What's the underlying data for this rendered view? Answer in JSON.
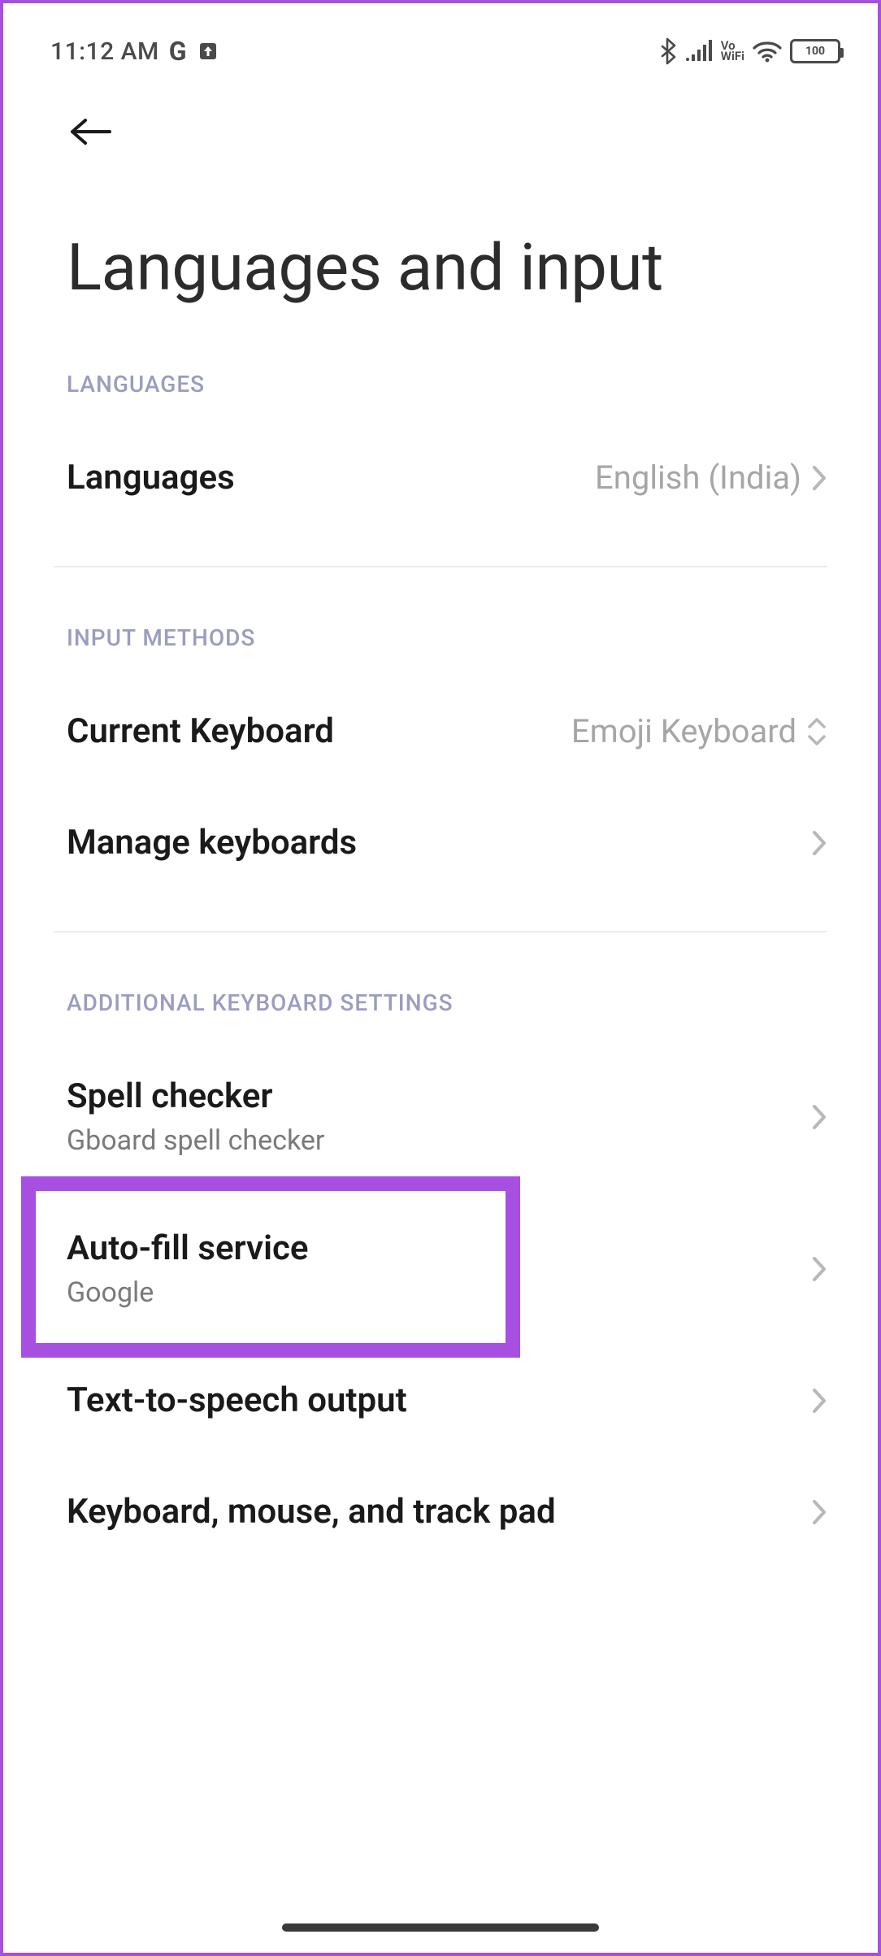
{
  "status": {
    "time": "11:12 AM",
    "g_label": "G",
    "vowifi_top": "Vo",
    "vowifi_bottom": "WiFi",
    "battery_pct": "100"
  },
  "page": {
    "title": "Languages and input"
  },
  "sections": {
    "languages": {
      "header": "LANGUAGES",
      "items": {
        "languages": {
          "label": "Languages",
          "value": "English (India)"
        }
      }
    },
    "input_methods": {
      "header": "INPUT METHODS",
      "items": {
        "current_keyboard": {
          "label": "Current Keyboard",
          "value": "Emoji Keyboard"
        },
        "manage_keyboards": {
          "label": "Manage keyboards"
        }
      }
    },
    "additional": {
      "header": "ADDITIONAL KEYBOARD SETTINGS",
      "items": {
        "spell_checker": {
          "label": "Spell checker",
          "sub": "Gboard spell checker"
        },
        "autofill": {
          "label": "Auto-fill service",
          "sub": "Google"
        },
        "tts": {
          "label": "Text-to-speech output"
        },
        "kbd_mouse": {
          "label": "Keyboard, mouse, and track pad"
        }
      }
    }
  }
}
